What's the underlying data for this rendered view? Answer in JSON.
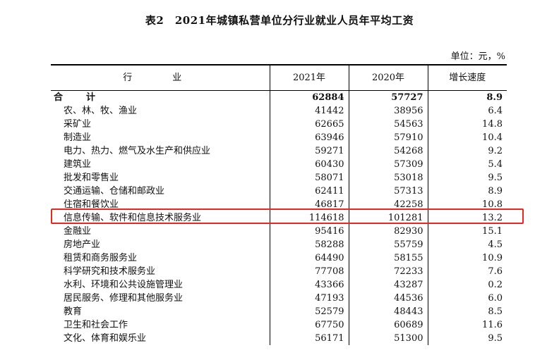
{
  "title": "表2　2021年城镇私营单位分行业就业人员年平均工资",
  "unit": "单位：元，%",
  "headers": [
    "行　业",
    "2021年",
    "2020年",
    "增长速度"
  ],
  "total": {
    "name": "合　计",
    "y2021": "62884",
    "y2020": "57727",
    "growth": "8.9"
  },
  "rows": [
    {
      "name": "农、林、牧、渔业",
      "y2021": "41442",
      "y2020": "38956",
      "growth": "6.4"
    },
    {
      "name": "采矿业",
      "y2021": "62665",
      "y2020": "54563",
      "growth": "14.8"
    },
    {
      "name": "制造业",
      "y2021": "63946",
      "y2020": "57910",
      "growth": "10.4"
    },
    {
      "name": "电力、热力、燃气及水生产和供应业",
      "y2021": "59271",
      "y2020": "54268",
      "growth": "9.2"
    },
    {
      "name": "建筑业",
      "y2021": "60430",
      "y2020": "57309",
      "growth": "5.4"
    },
    {
      "name": "批发和零售业",
      "y2021": "58071",
      "y2020": "53018",
      "growth": "9.5"
    },
    {
      "name": "交通运输、仓储和邮政业",
      "y2021": "62411",
      "y2020": "57313",
      "growth": "8.9"
    },
    {
      "name": "住宿和餐饮业",
      "y2021": "46817",
      "y2020": "42258",
      "growth": "10.8"
    },
    {
      "name": "信息传输、软件和信息技术服务业",
      "y2021": "114618",
      "y2020": "101281",
      "growth": "13.2"
    },
    {
      "name": "金融业",
      "y2021": "95416",
      "y2020": "82930",
      "growth": "15.1"
    },
    {
      "name": "房地产业",
      "y2021": "58288",
      "y2020": "55759",
      "growth": "4.5"
    },
    {
      "name": "租赁和商务服务业",
      "y2021": "64490",
      "y2020": "58155",
      "growth": "10.9"
    },
    {
      "name": "科学研究和技术服务业",
      "y2021": "77708",
      "y2020": "72233",
      "growth": "7.6"
    },
    {
      "name": "水利、环境和公共设施管理业",
      "y2021": "43366",
      "y2020": "43287",
      "growth": "0.2"
    },
    {
      "name": "居民服务、修理和其他服务业",
      "y2021": "47193",
      "y2020": "44536",
      "growth": "6.0"
    },
    {
      "name": "教育",
      "y2021": "52579",
      "y2020": "48443",
      "growth": "8.5"
    },
    {
      "name": "卫生和社会工作",
      "y2021": "67750",
      "y2020": "60689",
      "growth": "11.6"
    },
    {
      "name": "文化、体育和娱乐业",
      "y2021": "56171",
      "y2020": "51300",
      "growth": "9.5"
    }
  ],
  "highlight_color": "#e8281e"
}
